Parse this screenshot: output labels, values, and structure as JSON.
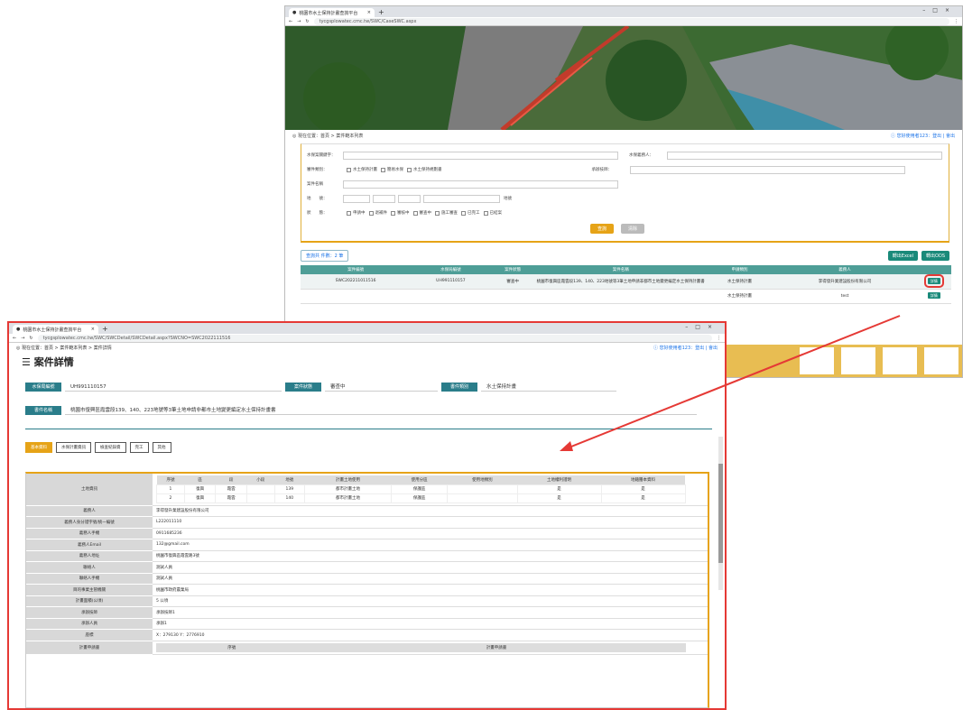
{
  "back_window": {
    "tab_title": "桃園市水土保持計畫查詢平台",
    "url": "tycgsplowatec.cmc.tw/SWC/CaseSWC.aspx",
    "breadcrumb": "◎ 現在位置：首頁 > 案件範本列表",
    "user_links": "ⓘ 您好使用者123：登出 | 會出",
    "search": {
      "case_keyword_label": "水保案關鍵字：",
      "applicant_label": "水保義務人：",
      "case_type_label": "審件類別：",
      "case_type_options": [
        "水土保持計畫",
        "簡易水保",
        "水土保持規劃書"
      ],
      "approver_label": "承辦技師：",
      "case_name_label": "案件名稱",
      "location_label": "地　　號：",
      "location_unit": "地號",
      "status_label": "狀　　態：",
      "status_options": [
        "申請中",
        "退補件",
        "審核中",
        "審查中",
        "施工審查",
        "已完工",
        "已結案"
      ],
      "query_button": "查詢",
      "clear_button": "清除"
    },
    "result_count": "查詢共 件數：2 筆",
    "export_buttons": [
      "轉出Excel",
      "轉出ODS"
    ],
    "columns": [
      "案件編號",
      "水保局編號",
      "案件狀態",
      "案件名稱",
      "申請類別",
      "義務人",
      ""
    ],
    "rows": [
      {
        "id": "SWC202211011516",
        "no": "UH991110157",
        "status": "審查中",
        "name": "桃園市復興區霞雲段139、140、223地號等3筆土地申請非都市土地變更編定水土保持計畫書",
        "type": "水土保持計畫",
        "owner": "李得發升業建設股份有限公司",
        "btn": "詳情"
      },
      {
        "id": "",
        "no": "",
        "status": "",
        "name": "",
        "type": "水土保持計畫",
        "owner": "test",
        "btn": "詳情"
      }
    ]
  },
  "front_window": {
    "tab_title": "桃園市水土保持計畫查詢平台",
    "url": "tycgsplowatec.cmc.tw/SWC/SWCDetail/SWCDetail.aspx?SWCNO=SWC2022111516",
    "breadcrumb": "◎ 現在位置：首頁 > 案件範本列表 > 案件詳情",
    "user_links": "ⓘ 您好使用者123：登出 | 會出",
    "page_title": "☰ 案件詳情",
    "fields": {
      "case_no_label": "水保局編號",
      "case_no": "UH991110157",
      "status_label": "案件狀態",
      "status": "審查中",
      "type_label": "書件類別",
      "type": "水土保持計畫",
      "name_label": "書件名稱",
      "name": "桃園市復興區霞雲段139、140、223地號等3筆土地申請非都市土地變更編定水土保持計畫書"
    },
    "tab_buttons": [
      "基本資料",
      "水保計畫資訊",
      "檢查紀錄資",
      "完工",
      "其他"
    ],
    "land_header": [
      "序號",
      "區",
      "段",
      "小段",
      "地號",
      "計畫土地使用",
      "使用分區",
      "使用地類別",
      "土地權利證明",
      "地籍謄本資料"
    ],
    "land_rows": [
      [
        "1",
        "復興",
        "霞雲",
        "",
        "139",
        "都市計畫土地",
        "保護區",
        "",
        "是",
        "是"
      ],
      [
        "2",
        "復興",
        "霞雲",
        "",
        "140",
        "都市計畫土地",
        "保護區",
        "",
        "是",
        "是"
      ]
    ],
    "details": [
      {
        "k": "土地資訊",
        "v": ""
      },
      {
        "k": "義務人",
        "v": "李得發升業建設股份有限公司"
      },
      {
        "k": "義務人身分證字號/統一編號",
        "v": "L222011110"
      },
      {
        "k": "義務人手機",
        "v": "0911685236"
      },
      {
        "k": "義務人Email",
        "v": "132@gmail.com"
      },
      {
        "k": "義務人地址",
        "v": "桃園市復興區霞雲路3號"
      },
      {
        "k": "聯絡人",
        "v": "測試人員"
      },
      {
        "k": "聯絡人手機",
        "v": "測試人員"
      },
      {
        "k": "目的事業主管機關",
        "v": "桃園市政府農業局"
      },
      {
        "k": "計畫面積(公頃)",
        "v": "5 公頃"
      },
      {
        "k": "承辦技師",
        "v": "承辦技師1"
      },
      {
        "k": "承辦人員",
        "v": "承辦1"
      },
      {
        "k": "座標",
        "v": "X：279130 Y：2776910"
      }
    ],
    "bottom_header": [
      "序號",
      "計畫申請書"
    ],
    "bottom_label": "計畫申請書"
  },
  "colors": {
    "accent": "#e6a317",
    "teal": "#2a7d8a",
    "highlight": "#e53935"
  }
}
